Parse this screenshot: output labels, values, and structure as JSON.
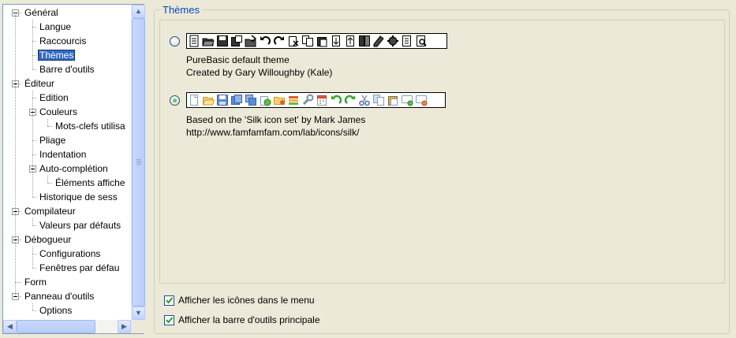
{
  "tree": {
    "items": [
      {
        "label": "Général",
        "level": 0,
        "expanded": true
      },
      {
        "label": "Langue",
        "level": 1
      },
      {
        "label": "Raccourcis",
        "level": 1
      },
      {
        "label": "Thèmes",
        "level": 1,
        "selected": true
      },
      {
        "label": "Barre d'outils",
        "level": 1
      },
      {
        "label": "Éditeur",
        "level": 0,
        "expanded": true
      },
      {
        "label": "Edition",
        "level": 1
      },
      {
        "label": "Couleurs",
        "level": 1,
        "expanded": true
      },
      {
        "label": "Mots-clefs utilisa",
        "level": 2
      },
      {
        "label": "Pliage",
        "level": 1
      },
      {
        "label": "Indentation",
        "level": 1
      },
      {
        "label": "Auto-complétion",
        "level": 1,
        "expanded": true
      },
      {
        "label": "Éléments affiche",
        "level": 2
      },
      {
        "label": "Historique de sess",
        "level": 1
      },
      {
        "label": "Compilateur",
        "level": 0,
        "expanded": true
      },
      {
        "label": "Valeurs par défauts",
        "level": 1
      },
      {
        "label": "Débogueur",
        "level": 0,
        "expanded": true
      },
      {
        "label": "Configurations",
        "level": 1
      },
      {
        "label": "Fenêtres par défau",
        "level": 1
      },
      {
        "label": "Form",
        "level": 0
      },
      {
        "label": "Panneau d'outils",
        "level": 0,
        "expanded": true
      },
      {
        "label": "Options",
        "level": 1
      }
    ]
  },
  "themes": {
    "title": "Thèmes",
    "options": [
      {
        "name": "purebasic-default",
        "checked": false,
        "line1": "PureBasic default theme",
        "line2": "Created by Gary Willoughby (Kale)"
      },
      {
        "name": "silk",
        "checked": true,
        "line1": "Based on the 'Silk icon set' by Mark James",
        "line2": "http://www.famfamfam.com/lab/icons/silk/"
      }
    ]
  },
  "checkboxes": {
    "menu_icons": {
      "label": "Afficher les icônes dans le menu",
      "checked": true
    },
    "main_toolbar": {
      "label": "Afficher la barre d'outils principale",
      "checked": true
    }
  }
}
